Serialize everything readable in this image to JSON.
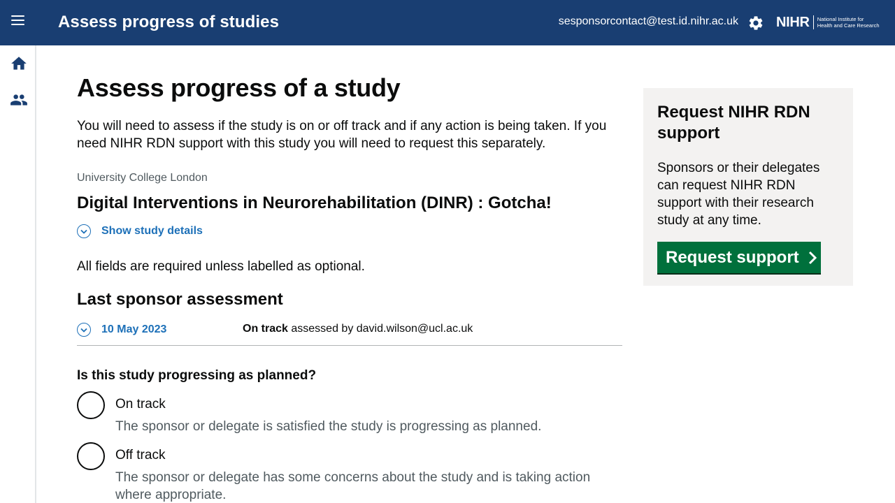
{
  "header": {
    "app_title": "Assess progress of studies",
    "user_email": "sesponsorcontact@test.id.nihr.ac.uk",
    "logo_main": "NIHR",
    "logo_sub_line1": "National Institute for",
    "logo_sub_line2": "Health and Care Research",
    "icons": [
      "menu-icon",
      "gear-icon"
    ]
  },
  "sidenav": {
    "items": [
      {
        "icon": "home-icon"
      },
      {
        "icon": "people-icon"
      }
    ]
  },
  "main": {
    "page_title": "Assess progress of a study",
    "intro": "You will need to assess if the study is on or off track and if any action is being taken. If you need NIHR RDN support with this study you will need to request this separately.",
    "organisation": "University College London",
    "study_title": "Digital Interventions in Neurorehabilitation (DINR) : Gotcha!",
    "show_details_label": "Show study details",
    "required_note": "All fields are required unless labelled as optional.",
    "last_assessment": {
      "heading": "Last sponsor assessment",
      "date": "10 May 2023",
      "status": "On track",
      "assessed_by_text": "assessed by david.wilson@ucl.ac.uk"
    },
    "question": "Is this study progressing as planned?",
    "options": [
      {
        "label": "On track",
        "hint": "The sponsor or delegate is satisfied the study is progressing as planned."
      },
      {
        "label": "Off track",
        "hint": "The sponsor or delegate has some concerns about the study and is taking action where appropriate."
      }
    ]
  },
  "side_panel": {
    "title": "Request NIHR RDN support",
    "text": "Sponsors or their delegates can request NIHR RDN support with their research study at any time.",
    "button_label": "Request support"
  },
  "colors": {
    "header_bg": "#193e72",
    "link": "#1d70b8",
    "button_green": "#00703c",
    "panel_bg": "#f3f2f1"
  }
}
